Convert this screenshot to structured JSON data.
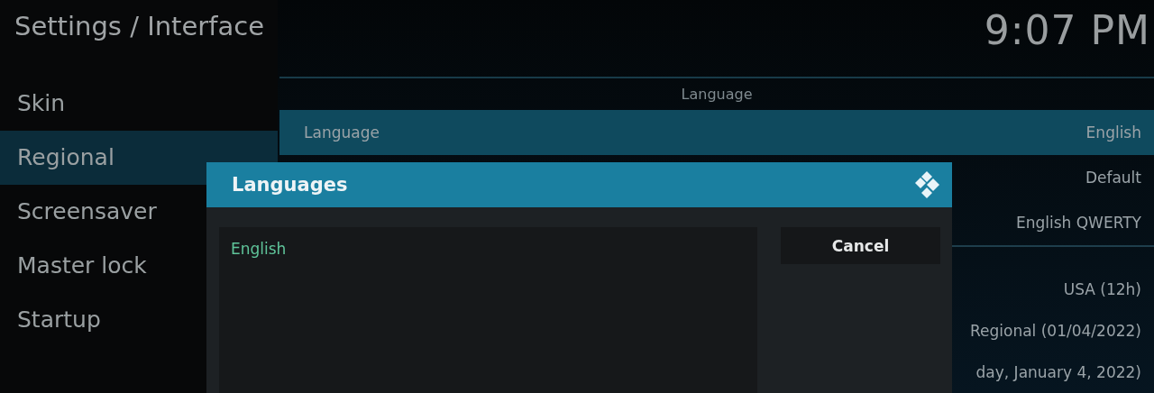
{
  "header": {
    "title": "Settings / Interface",
    "clock": "9:07 PM"
  },
  "sidebar": {
    "items": [
      {
        "label": "Skin",
        "selected": false
      },
      {
        "label": "Regional",
        "selected": true
      },
      {
        "label": "Screensaver",
        "selected": false
      },
      {
        "label": "Master lock",
        "selected": false
      },
      {
        "label": "Startup",
        "selected": false
      }
    ]
  },
  "settings": {
    "groups": [
      {
        "title": "Language",
        "rows": [
          {
            "label": "Language",
            "value": "English",
            "selected": true
          },
          {
            "value": "Default",
            "selected": false
          },
          {
            "value": "English QWERTY",
            "selected": false
          }
        ]
      },
      {
        "rows": [
          {
            "value": "USA (12h)",
            "selected": false
          },
          {
            "value": "Regional (01/04/2022)",
            "selected": false
          },
          {
            "value": "day, January 4, 2022)",
            "selected": false
          }
        ]
      }
    ]
  },
  "dialog": {
    "title": "Languages",
    "items": [
      {
        "label": "English",
        "selected": true
      }
    ],
    "buttons": [
      "Cancel"
    ]
  }
}
